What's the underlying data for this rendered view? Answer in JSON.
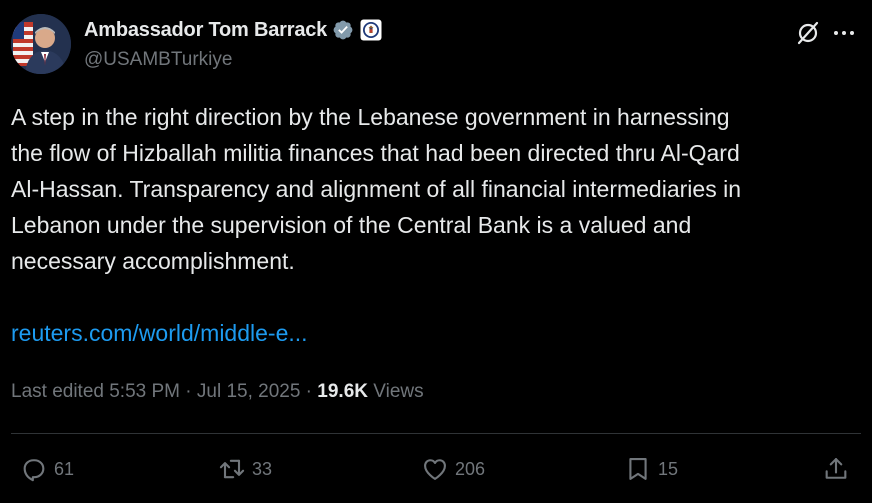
{
  "author": {
    "display_name": "Ambassador Tom Barrack",
    "handle": "@USAMBTurkiye"
  },
  "tweet": {
    "lines": [
      "A step in the right direction by the Lebanese government in harnessing",
      "the flow of Hizballah militia finances that had been directed thru Al-Qard",
      "Al-Hassan. Transparency and alignment of all financial intermediaries in",
      "Lebanon under the supervision of the Central Bank is a valued and",
      "necessary accomplishment."
    ],
    "link": "reuters.com/world/middle-e..."
  },
  "meta": {
    "edited_prefix": "Last edited 5:53 PM · Jul 15, 2025 · ",
    "views_count": "19.6K",
    "views_label": " Views"
  },
  "actions": {
    "replies": "61",
    "reposts": "33",
    "likes": "206",
    "bookmarks": "15"
  },
  "icons": {
    "verified": "verified-badge-icon",
    "affiliation": "government-seal-icon",
    "grok": "grok-icon",
    "more": "more-icon",
    "reply": "reply-icon",
    "repost": "repost-icon",
    "like": "heart-icon",
    "bookmark": "bookmark-icon",
    "share": "share-icon"
  },
  "colors": {
    "background": "#000000",
    "text": "#e7e9ea",
    "secondary": "#71767b",
    "link": "#1d9bf0",
    "verified": "#829aab",
    "divider": "#2f3336"
  }
}
